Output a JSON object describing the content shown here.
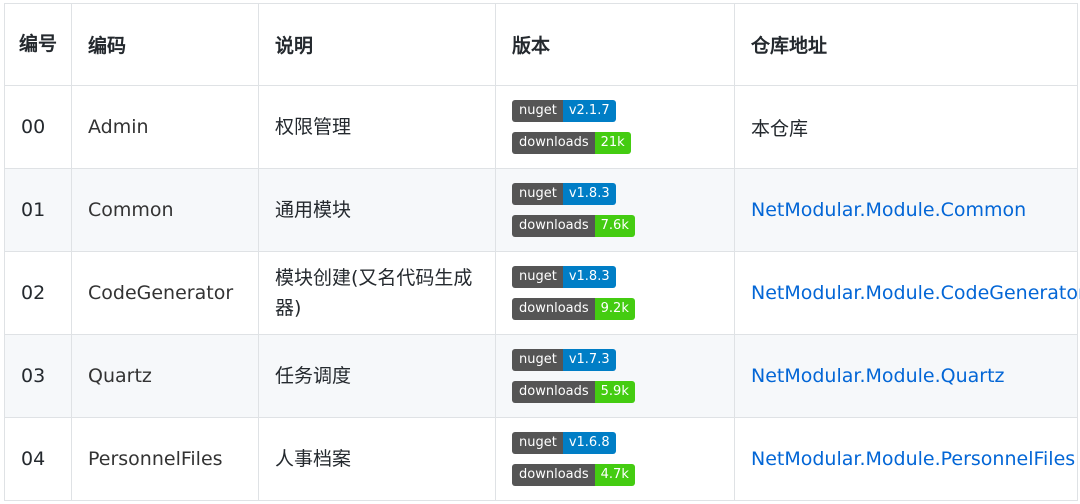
{
  "headers": {
    "no": "编号",
    "code": "编码",
    "desc": "说明",
    "version": "版本",
    "repo": "仓库地址"
  },
  "badge_labels": {
    "nuget": "nuget",
    "downloads": "downloads"
  },
  "colors": {
    "nuget_value": "#007ec6",
    "downloads_value": "#44cc11",
    "badge_label": "#555555",
    "link": "#0366d6"
  },
  "rows": [
    {
      "no": "00",
      "code": "Admin",
      "desc": "权限管理",
      "nuget": "v2.1.7",
      "downloads": "21k",
      "repo": "本仓库"
    },
    {
      "no": "01",
      "code": "Common",
      "desc": "通用模块",
      "nuget": "v1.8.3",
      "downloads": "7.6k",
      "repo": "NetModular.Module.Common"
    },
    {
      "no": "02",
      "code": "CodeGenerator",
      "desc": "模块创建(又名代码生成器)",
      "nuget": "v1.8.3",
      "downloads": "9.2k",
      "repo": "NetModular.Module.CodeGenerator"
    },
    {
      "no": "03",
      "code": "Quartz",
      "desc": "任务调度",
      "nuget": "v1.7.3",
      "downloads": "5.9k",
      "repo": "NetModular.Module.Quartz"
    },
    {
      "no": "04",
      "code": "PersonnelFiles",
      "desc": "人事档案",
      "nuget": "v1.6.8",
      "downloads": "4.7k",
      "repo": "NetModular.Module.PersonnelFiles"
    }
  ]
}
